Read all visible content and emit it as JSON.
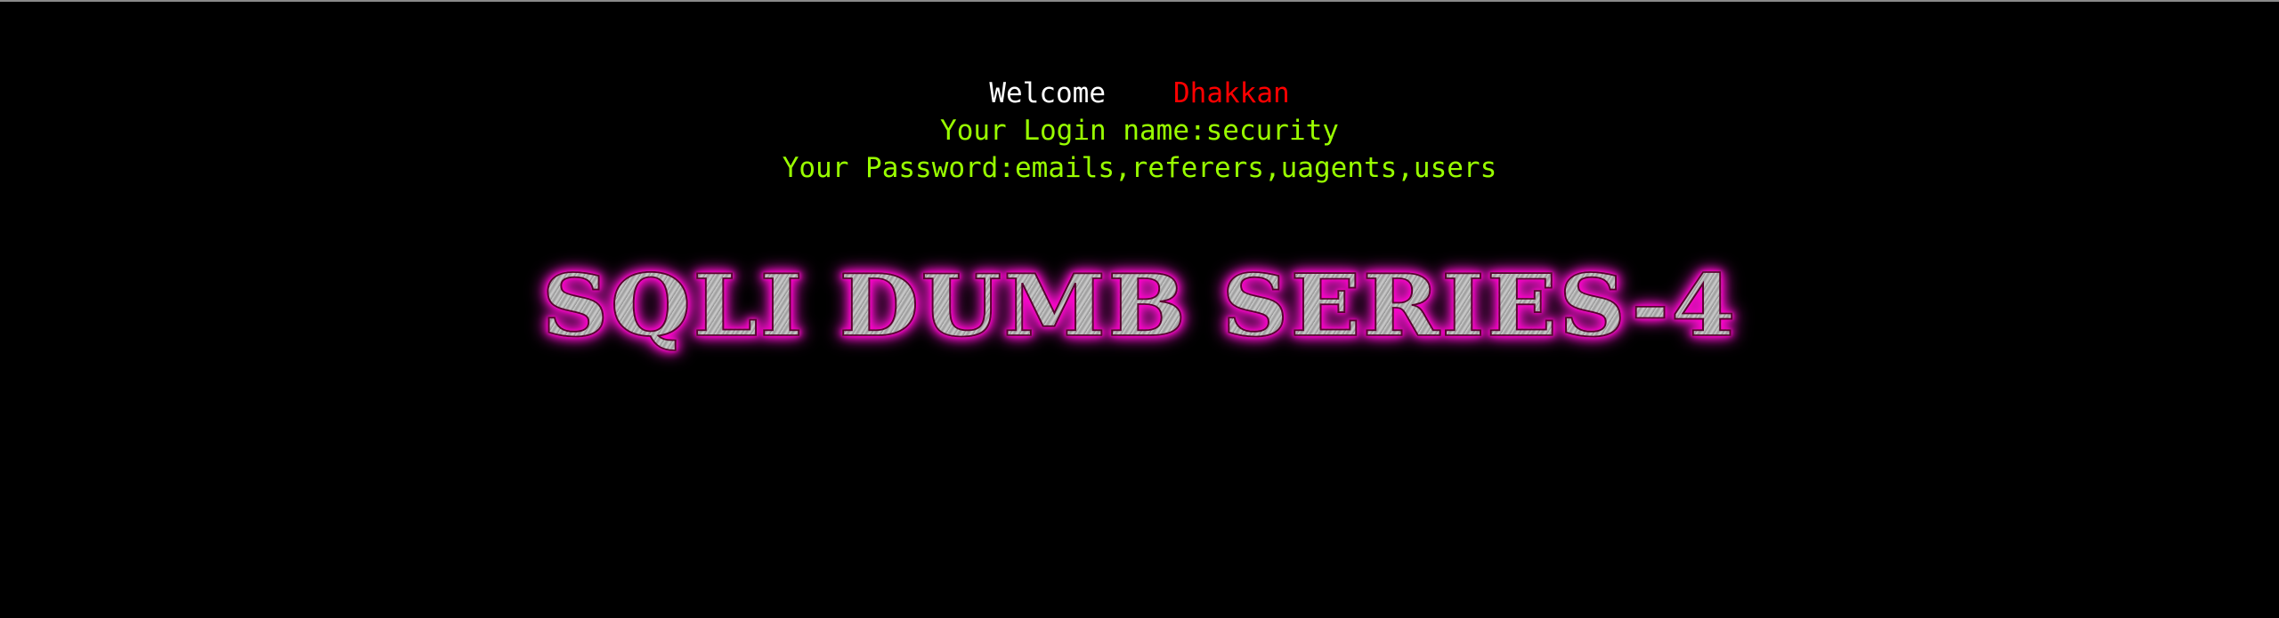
{
  "welcome": {
    "label": "Welcome",
    "name": "Dhakkan"
  },
  "login": {
    "text": "Your Login name:security"
  },
  "password": {
    "text": "Your Password:emails,referers,uagents,users"
  },
  "banner": {
    "title": "SQLI DUMB SERIES-4"
  },
  "colors": {
    "background": "#000000",
    "welcome": "#ffffff",
    "name": "#ff0000",
    "info": "#99ff00",
    "banner_glow": "#ff00cc",
    "banner_fill": "#b4b4b4"
  }
}
